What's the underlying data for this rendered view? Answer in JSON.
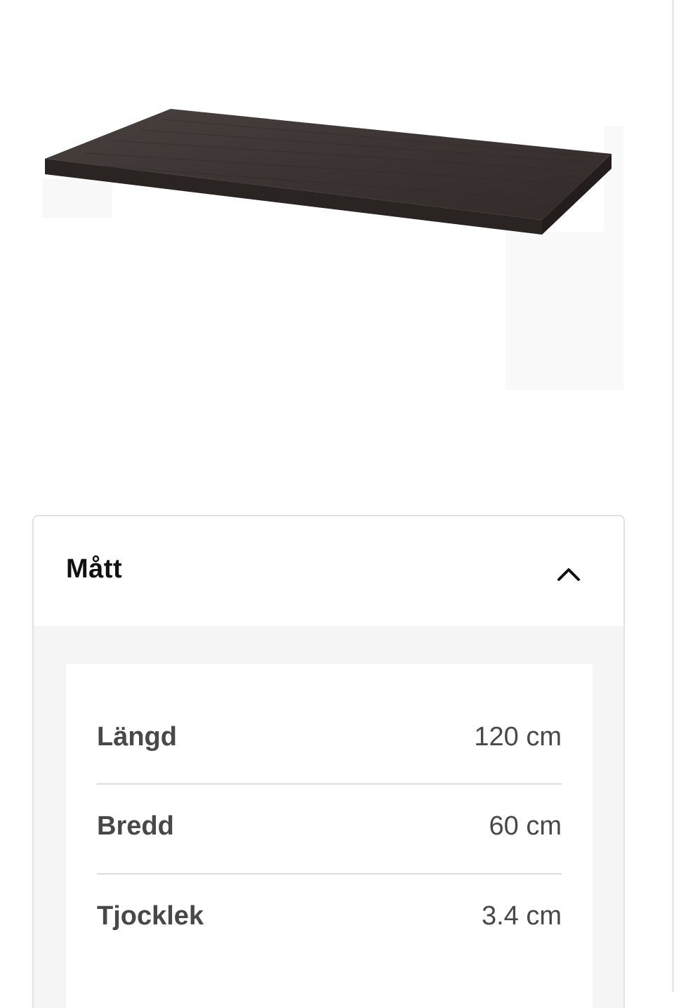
{
  "product_image": {
    "subject": "dark brown-black table top",
    "colors": {
      "top": "#3b3432",
      "edge": "#2a2422"
    }
  },
  "accordion": {
    "title": "Mått",
    "expanded": true,
    "toggle_icon": "chevron-up-icon"
  },
  "dimensions": [
    {
      "label": "Längd",
      "value": "120 cm"
    },
    {
      "label": "Bredd",
      "value": "60 cm"
    },
    {
      "label": "Tjocklek",
      "value": "3.4 cm"
    }
  ]
}
